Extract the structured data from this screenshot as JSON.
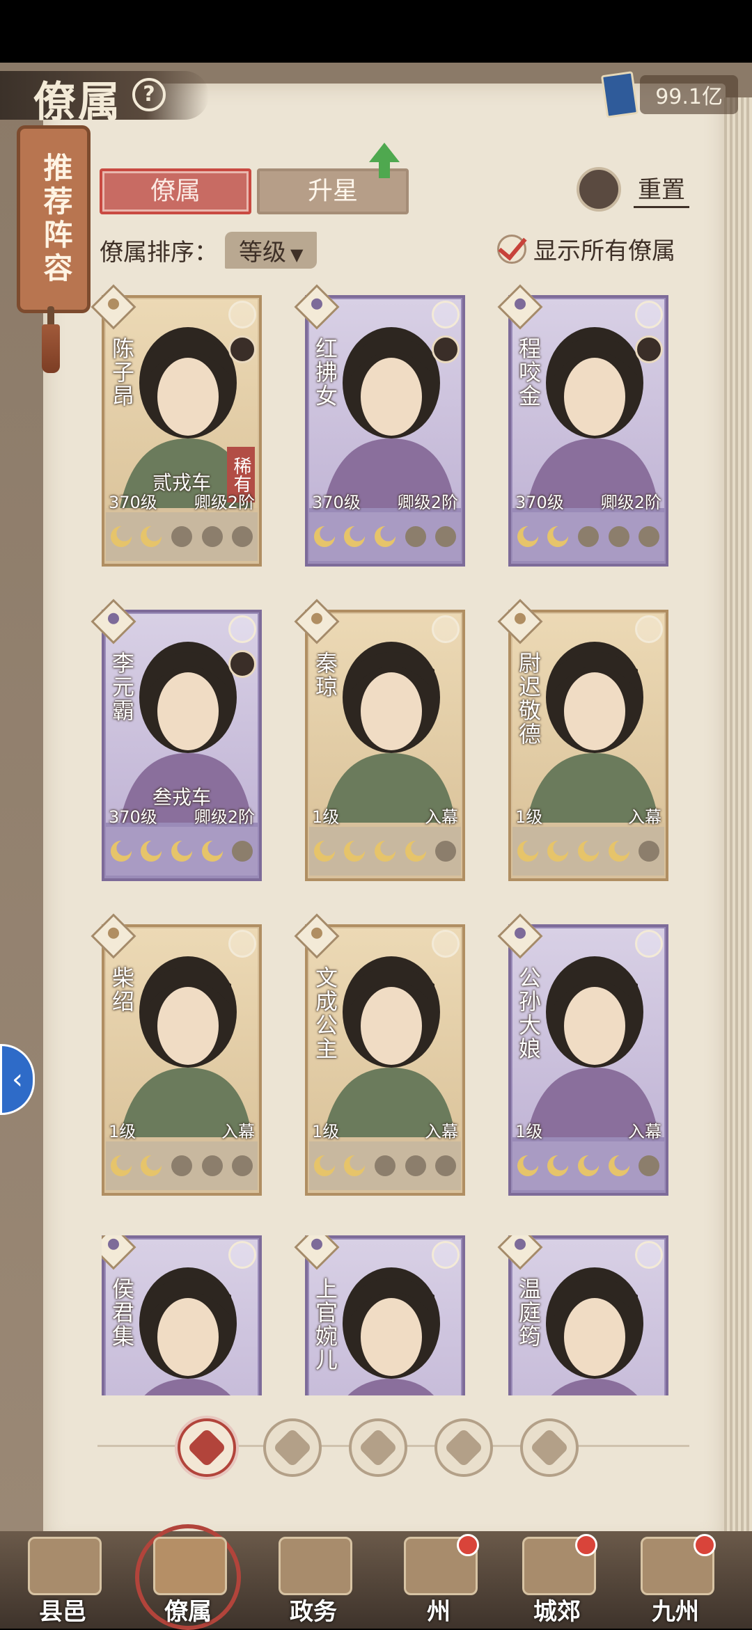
{
  "header": {
    "title": "僚属",
    "currency": "99.1亿"
  },
  "recommend_label": "推荐阵容",
  "tabs": [
    {
      "label": "僚属"
    },
    {
      "label": "升星"
    }
  ],
  "reset_label": "重置",
  "sort": {
    "label": "僚属排序：",
    "value": "等级"
  },
  "show_all_label": "显示所有僚属",
  "cards": [
    {
      "name": "陈子昂",
      "level": "370级",
      "rank": "卿级2阶",
      "center_label": "贰戎车",
      "rarity": "稀有",
      "stars_on": 2,
      "color": "gold"
    },
    {
      "name": "红拂女",
      "level": "370级",
      "rank": "卿级2阶",
      "center_label": "",
      "rarity": "",
      "stars_on": 3,
      "color": "purple"
    },
    {
      "name": "程咬金",
      "level": "370级",
      "rank": "卿级2阶",
      "center_label": "",
      "rarity": "",
      "stars_on": 2,
      "color": "purple"
    },
    {
      "name": "李元霸",
      "level": "370级",
      "rank": "卿级2阶",
      "center_label": "叁戎车",
      "rarity": "",
      "stars_on": 4,
      "color": "purple"
    },
    {
      "name": "秦琼",
      "level": "1级",
      "rank": "入幕",
      "center_label": "",
      "rarity": "",
      "stars_on": 4,
      "color": "gold"
    },
    {
      "name": "尉迟敬德",
      "level": "1级",
      "rank": "入幕",
      "center_label": "",
      "rarity": "",
      "stars_on": 4,
      "color": "gold"
    },
    {
      "name": "柴绍",
      "level": "1级",
      "rank": "入幕",
      "center_label": "",
      "rarity": "",
      "stars_on": 2,
      "color": "gold"
    },
    {
      "name": "文成公主",
      "level": "1级",
      "rank": "入幕",
      "center_label": "",
      "rarity": "",
      "stars_on": 2,
      "color": "gold"
    },
    {
      "name": "公孙大娘",
      "level": "1级",
      "rank": "入幕",
      "center_label": "",
      "rarity": "",
      "stars_on": 4,
      "color": "purple"
    }
  ],
  "partial_cards": [
    {
      "name": "侯君集",
      "color": "purple"
    },
    {
      "name": "上官婉儿",
      "color": "purple"
    },
    {
      "name": "温庭筠",
      "color": "purple"
    }
  ],
  "bottom_nav": [
    {
      "label": "县邑",
      "icon": "county-building-icon",
      "badge": false
    },
    {
      "label": "僚属",
      "icon": "retainers-scroll-icon",
      "badge": false
    },
    {
      "label": "政务",
      "icon": "affairs-documents-icon",
      "badge": false
    },
    {
      "label": "州",
      "icon": "prefecture-mountain-icon",
      "badge": true
    },
    {
      "label": "城郊",
      "icon": "suburb-village-icon",
      "badge": true
    },
    {
      "label": "九州",
      "icon": "nine-provinces-map-icon",
      "badge": true
    }
  ],
  "colors": {
    "accent_red": "#c86b63",
    "purple_card": "#9a8bb8",
    "gold_card": "#d8c19c",
    "paper": "#ece4d4"
  }
}
